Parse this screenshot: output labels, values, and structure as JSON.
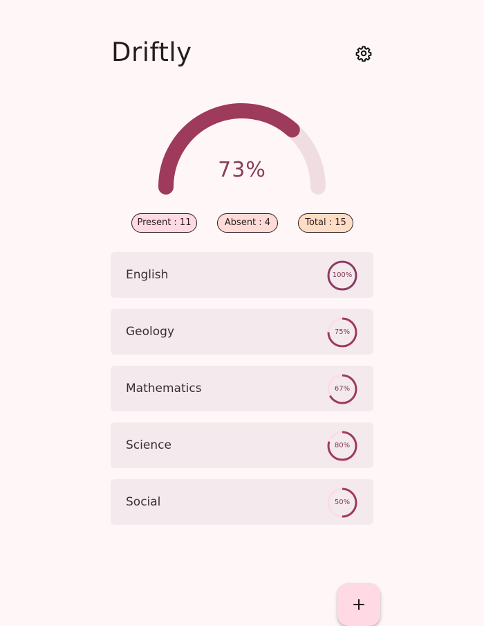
{
  "app": {
    "title": "Driftly"
  },
  "header": {
    "settings_icon": "gear-icon"
  },
  "overall": {
    "percent_label": "73%",
    "percent_value": 73,
    "track_color": "#f0dde2",
    "fill_color": "#9e3a5b"
  },
  "stats": {
    "present": "Present : 11",
    "absent": "Absent : 4",
    "total": "Total : 15"
  },
  "subjects": [
    {
      "name": "English",
      "percent": 100,
      "percent_label": "100%"
    },
    {
      "name": "Geology",
      "percent": 75,
      "percent_label": "75%"
    },
    {
      "name": "Mathematics",
      "percent": 67,
      "percent_label": "67%"
    },
    {
      "name": "Science",
      "percent": 80,
      "percent_label": "80%"
    },
    {
      "name": "Social",
      "percent": 50,
      "percent_label": "50%"
    }
  ],
  "fab": {
    "icon": "plus-icon"
  }
}
